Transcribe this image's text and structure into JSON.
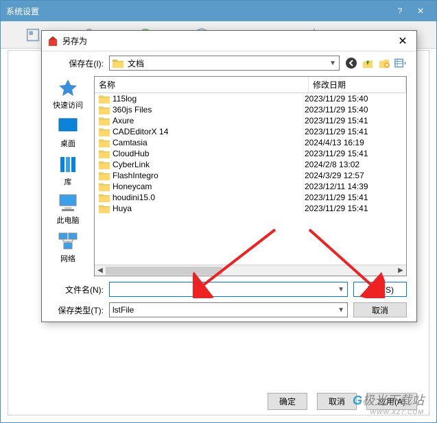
{
  "parent": {
    "title": "系统设置",
    "buttons": {
      "ok": "确定",
      "cancel": "取消",
      "apply": "应用(A)"
    }
  },
  "watermark": {
    "text": "极光下载站",
    "sub": "WWW.XZ7.COM"
  },
  "dialog": {
    "title": "另存为",
    "location_label": "保存在(I):",
    "location_value": "文档",
    "places": {
      "quick": "快速访问",
      "desktop": "桌面",
      "library": "库",
      "thispc": "此电脑",
      "network": "网络"
    },
    "columns": {
      "name": "名称",
      "modified": "修改日期"
    },
    "files": [
      {
        "name": "115log",
        "date": "2023/11/29 15:40"
      },
      {
        "name": "360js Files",
        "date": "2023/11/29 15:40"
      },
      {
        "name": "Axure",
        "date": "2023/11/29 15:41"
      },
      {
        "name": "CADEditorX 14",
        "date": "2023/11/29 15:41"
      },
      {
        "name": "Camtasia",
        "date": "2024/4/13 16:19"
      },
      {
        "name": "CloudHub",
        "date": "2023/11/29 15:41"
      },
      {
        "name": "CyberLink",
        "date": "2024/2/8 13:02"
      },
      {
        "name": "FlashIntegro",
        "date": "2024/3/29 12:57"
      },
      {
        "name": "Honeycam",
        "date": "2023/12/11 14:39"
      },
      {
        "name": "houdini15.0",
        "date": "2023/11/29 15:41"
      },
      {
        "name": "Huya",
        "date": "2023/11/29 15:41"
      }
    ],
    "filename_label": "文件名(N):",
    "filename_value": "",
    "filetype_label": "保存类型(T):",
    "filetype_value": "lstFile",
    "save_btn": "保存(S)",
    "cancel_btn": "取消"
  }
}
